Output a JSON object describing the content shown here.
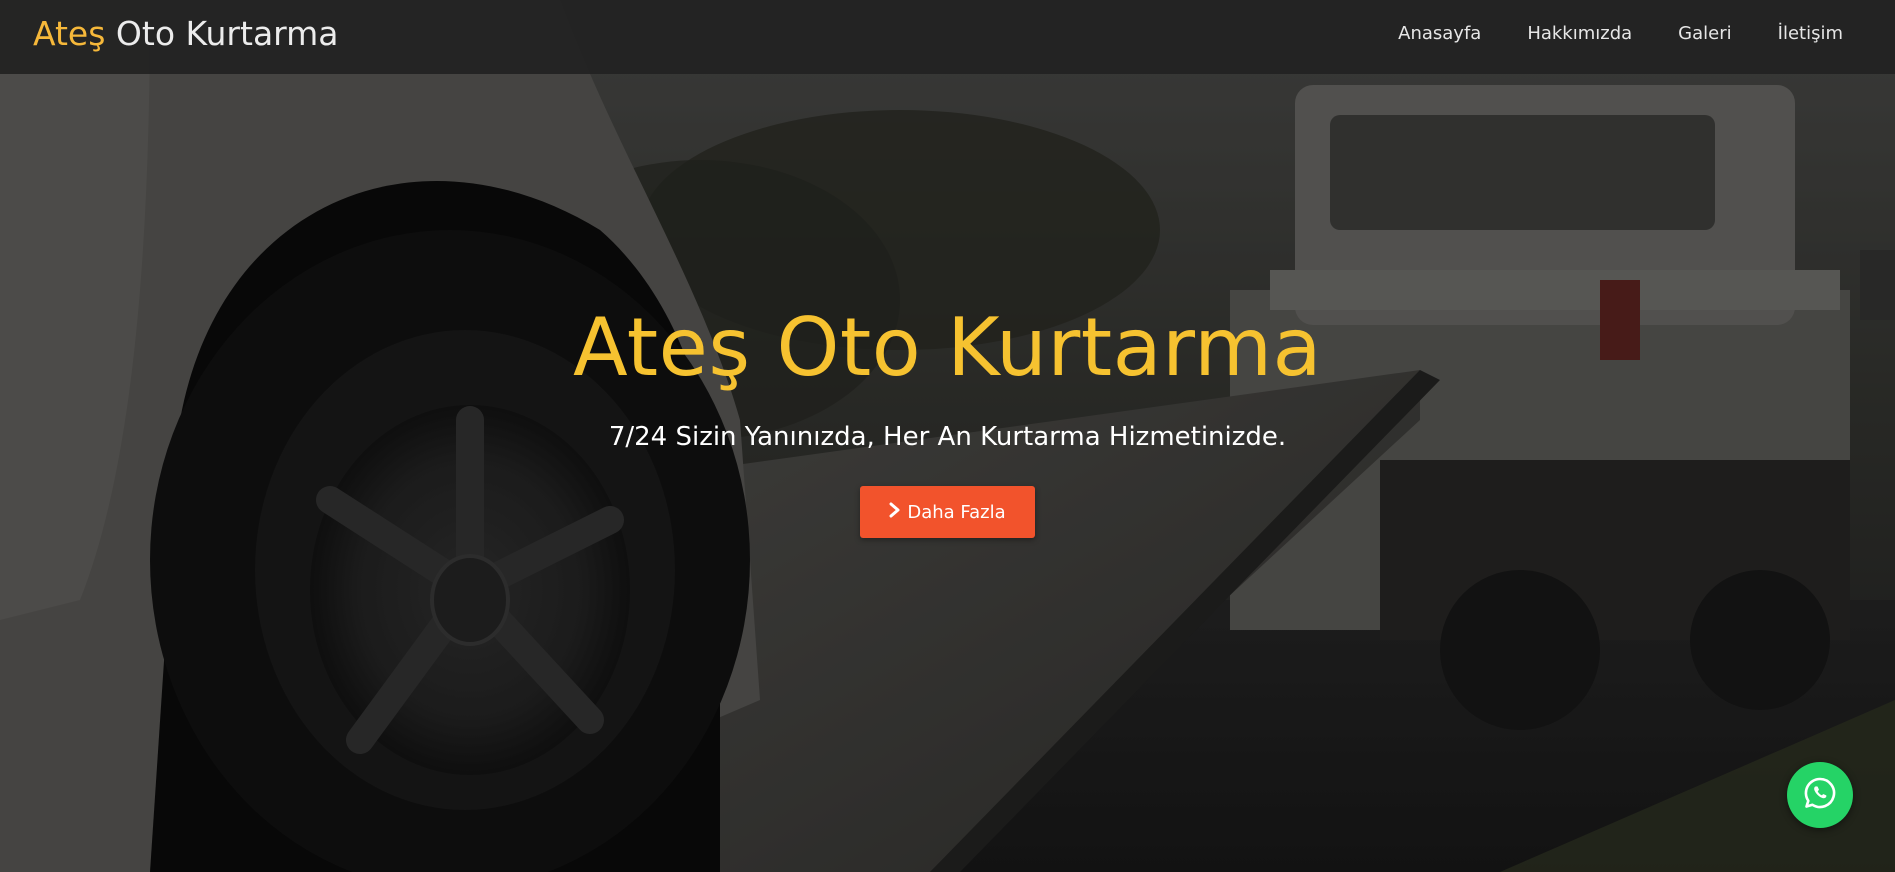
{
  "brand": {
    "accent": "Ateş",
    "rest": " Oto Kurtarma"
  },
  "nav": {
    "items": [
      {
        "label": "Anasayfa"
      },
      {
        "label": "Hakkımızda"
      },
      {
        "label": "Galeri"
      },
      {
        "label": "İletişim"
      }
    ]
  },
  "hero": {
    "title": "Ateş Oto Kurtarma",
    "subtitle": "7/24 Sizin Yanınızda, Her An Kurtarma Hizmetinizde.",
    "cta_label": "Daha Fazla",
    "cta_icon": "chevron-right-icon"
  },
  "floating": {
    "whatsapp_icon": "whatsapp-icon"
  },
  "colors": {
    "title_yellow": "#f6c230",
    "brand_accent": "#f6b83a",
    "cta_orange": "#f2532c",
    "whatsapp_green": "#25d366",
    "navbar_bg": "#222222"
  }
}
